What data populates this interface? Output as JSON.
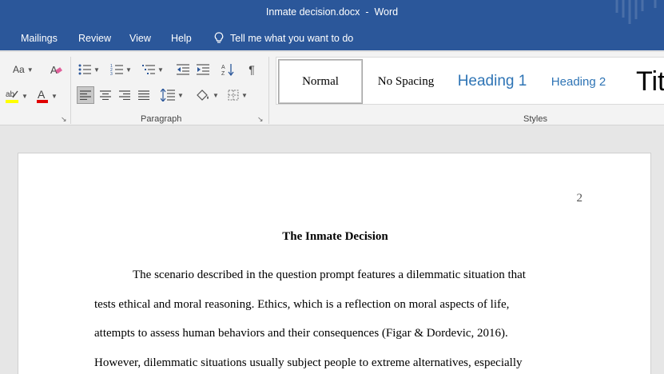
{
  "window": {
    "doc_name": "Inmate decision.docx",
    "separator": "-",
    "app_name": "Word"
  },
  "menu": {
    "tabs": [
      "Mailings",
      "Review",
      "View",
      "Help"
    ],
    "tell_me": "Tell me what you want to do"
  },
  "ribbon": {
    "change_case_label": "Aa",
    "paragraph_label": "Paragraph",
    "styles_label": "Styles",
    "styles": [
      "Normal",
      "No Spacing",
      "Heading 1",
      "Heading 2",
      "Title"
    ],
    "colors": {
      "highlight": "#ffff00",
      "font_color": "#e00000",
      "accent": "#2b579a"
    }
  },
  "document": {
    "page_number": "2",
    "title": "The Inmate Decision",
    "lines": [
      "The scenario described in the question prompt features a dilemmatic situation that",
      "tests ethical and moral reasoning. Ethics, which is a reflection on moral aspects of life,",
      "attempts to assess human behaviors and their consequences (Figar & Dordevic, 2016).",
      "However, dilemmatic situations usually subject people to extreme alternatives, especially"
    ]
  }
}
